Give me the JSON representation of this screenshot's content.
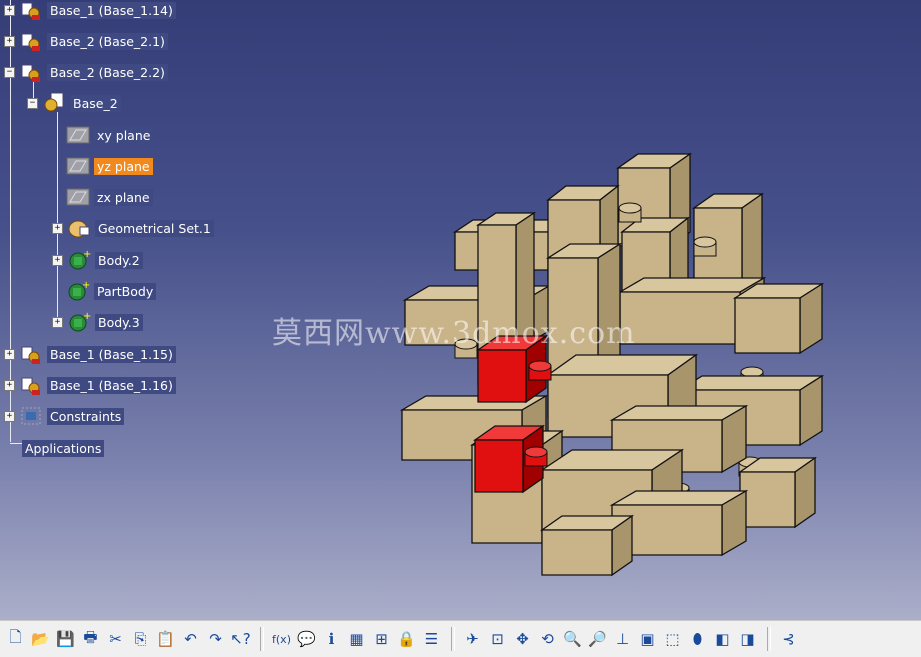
{
  "tree": {
    "nodes": [
      {
        "label": "Base_1 (Base_1.14)",
        "expander": "+",
        "icon": "product"
      },
      {
        "label": "Base_2 (Base_2.1)",
        "expander": "+",
        "icon": "product"
      },
      {
        "label": "Base_2 (Base_2.2)",
        "expander": "−",
        "icon": "product"
      },
      {
        "label": "Base_2",
        "expander": "−",
        "icon": "part"
      },
      {
        "label": "xy plane",
        "expander": "",
        "icon": "plane"
      },
      {
        "label": "yz plane",
        "expander": "",
        "icon": "plane",
        "selected": true
      },
      {
        "label": "zx plane",
        "expander": "",
        "icon": "plane"
      },
      {
        "label": "Geometrical Set.1",
        "expander": "+",
        "icon": "geoset"
      },
      {
        "label": "Body.2",
        "expander": "+",
        "icon": "body"
      },
      {
        "label": "PartBody",
        "expander": "",
        "icon": "body"
      },
      {
        "label": "Body.3",
        "expander": "+",
        "icon": "body"
      },
      {
        "label": "Base_1 (Base_1.15)",
        "expander": "+",
        "icon": "product"
      },
      {
        "label": "Base_1 (Base_1.16)",
        "expander": "+",
        "icon": "product"
      },
      {
        "label": "Constraints",
        "expander": "+",
        "icon": "constraints"
      },
      {
        "label": "Applications",
        "expander": "",
        "icon": "none"
      }
    ]
  },
  "watermark": "莫西网www.3dmox.com",
  "colors": {
    "wood": "#c9b48a",
    "wood_top": "#d8c69e",
    "wood_side": "#a8956c",
    "red": "#e01010",
    "red_dark": "#a00000",
    "selection": "#f0891e"
  },
  "toolbar": {
    "buttons": [
      {
        "icon": "new-icon",
        "glyph": "🗋"
      },
      {
        "icon": "open-icon",
        "glyph": "📂"
      },
      {
        "icon": "save-icon",
        "glyph": "💾"
      },
      {
        "icon": "print-icon",
        "glyph": "🖶"
      },
      {
        "icon": "cut-icon",
        "glyph": "✂"
      },
      {
        "icon": "copy-icon",
        "glyph": "⎘"
      },
      {
        "icon": "paste-icon",
        "glyph": "📋"
      },
      {
        "icon": "undo-icon",
        "glyph": "↶"
      },
      {
        "icon": "redo-icon",
        "glyph": "↷"
      },
      {
        "icon": "whats-this-icon",
        "glyph": "↖?"
      },
      {
        "sep": true
      },
      {
        "icon": "formula-icon",
        "glyph": "f(x)"
      },
      {
        "icon": "comment-icon",
        "glyph": "💬"
      },
      {
        "icon": "knowledge-icon",
        "glyph": "ℹ"
      },
      {
        "icon": "table-icon",
        "glyph": "▦"
      },
      {
        "icon": "tree-icon",
        "glyph": "⊞"
      },
      {
        "icon": "lock-icon",
        "glyph": "🔒"
      },
      {
        "icon": "list-icon",
        "glyph": "☰"
      },
      {
        "sep": true
      },
      {
        "icon": "fly-icon",
        "glyph": "✈"
      },
      {
        "icon": "fit-all-icon",
        "glyph": "⊡"
      },
      {
        "icon": "pan-icon",
        "glyph": "✥"
      },
      {
        "icon": "rotate-icon",
        "glyph": "⟲"
      },
      {
        "icon": "zoom-in-icon",
        "glyph": "🔍"
      },
      {
        "icon": "zoom-out-icon",
        "glyph": "🔎"
      },
      {
        "icon": "normal-view-icon",
        "glyph": "⊥"
      },
      {
        "icon": "multi-view-icon",
        "glyph": "▣"
      },
      {
        "icon": "iso-view-icon",
        "glyph": "⬚"
      },
      {
        "icon": "shading-icon",
        "glyph": "⬮"
      },
      {
        "icon": "hide-show-icon",
        "glyph": "◧"
      },
      {
        "icon": "swap-visible-icon",
        "glyph": "◨"
      },
      {
        "sep": true
      },
      {
        "icon": "analysis-icon",
        "glyph": "⊰"
      }
    ]
  }
}
